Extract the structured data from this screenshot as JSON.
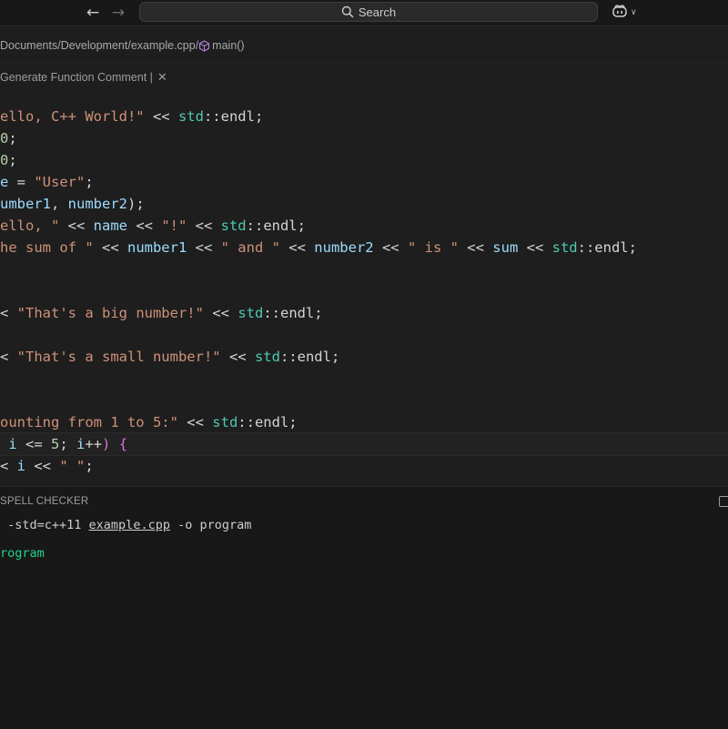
{
  "titlebar": {
    "search_label": "Search"
  },
  "breadcrumb": {
    "path": "Documents/Development/example.cpp/",
    "symbol": "main()"
  },
  "inline_hint": {
    "label": "Generate Function Comment |"
  },
  "code_lines": [
    [
      [
        "t-str",
        "ello, C++ World!\""
      ],
      [
        "t-op",
        " << "
      ],
      [
        "t-ns",
        "std"
      ],
      [
        "t-op",
        "::"
      ],
      [
        "t-plain",
        "endl;"
      ]
    ],
    [
      [
        "t-num",
        "0"
      ],
      [
        "t-plain",
        ";"
      ]
    ],
    [
      [
        "t-num",
        "0"
      ],
      [
        "t-plain",
        ";"
      ]
    ],
    [
      [
        "t-var",
        "e"
      ],
      [
        "t-op",
        " = "
      ],
      [
        "t-str",
        "\"User\""
      ],
      [
        "t-plain",
        ";"
      ]
    ],
    [
      [
        "t-var",
        "umber1"
      ],
      [
        "t-plain",
        ", "
      ],
      [
        "t-var",
        "number2"
      ],
      [
        "t-plain",
        ");"
      ]
    ],
    [
      [
        "t-str",
        "ello, \""
      ],
      [
        "t-op",
        " << "
      ],
      [
        "t-var",
        "name"
      ],
      [
        "t-op",
        " << "
      ],
      [
        "t-str",
        "\"!\""
      ],
      [
        "t-op",
        " << "
      ],
      [
        "t-ns",
        "std"
      ],
      [
        "t-op",
        "::"
      ],
      [
        "t-plain",
        "endl;"
      ]
    ],
    [
      [
        "t-str",
        "he sum of \""
      ],
      [
        "t-op",
        " << "
      ],
      [
        "t-var",
        "number1"
      ],
      [
        "t-op",
        " << "
      ],
      [
        "t-str",
        "\" and \""
      ],
      [
        "t-op",
        " << "
      ],
      [
        "t-var",
        "number2"
      ],
      [
        "t-op",
        " << "
      ],
      [
        "t-str",
        "\" is \""
      ],
      [
        "t-op",
        " << "
      ],
      [
        "t-var",
        "sum"
      ],
      [
        "t-op",
        " << "
      ],
      [
        "t-ns",
        "std"
      ],
      [
        "t-op",
        "::"
      ],
      [
        "t-plain",
        "endl;"
      ]
    ],
    [],
    [],
    [
      [
        "t-op",
        "< "
      ],
      [
        "t-str",
        "\"That's a big number!\""
      ],
      [
        "t-op",
        " << "
      ],
      [
        "t-ns",
        "std"
      ],
      [
        "t-op",
        "::"
      ],
      [
        "t-plain",
        "endl;"
      ]
    ],
    [],
    [
      [
        "t-op",
        "< "
      ],
      [
        "t-str",
        "\"That's a small number!\""
      ],
      [
        "t-op",
        " << "
      ],
      [
        "t-ns",
        "std"
      ],
      [
        "t-op",
        "::"
      ],
      [
        "t-plain",
        "endl;"
      ]
    ],
    [],
    [],
    [
      [
        "t-str",
        "ounting from 1 to 5:\""
      ],
      [
        "t-op",
        " << "
      ],
      [
        "t-ns",
        "std"
      ],
      [
        "t-op",
        "::"
      ],
      [
        "t-plain",
        "endl;"
      ]
    ],
    [
      [
        "t-var",
        " i"
      ],
      [
        "t-op",
        " <= "
      ],
      [
        "t-num",
        "5"
      ],
      [
        "t-plain",
        "; "
      ],
      [
        "t-var",
        "i"
      ],
      [
        "t-op",
        "++"
      ],
      [
        "t-brace",
        ") {"
      ]
    ],
    [
      [
        "t-op",
        "< "
      ],
      [
        "t-var",
        "i"
      ],
      [
        "t-op",
        " << "
      ],
      [
        "t-str",
        "\" \""
      ],
      [
        "t-plain",
        ";"
      ]
    ]
  ],
  "active_line_index": 15,
  "panel": {
    "tab_label": "SPELL CHECKER",
    "terminal_cmd_prefix": " -std=c++11 ",
    "terminal_cmd_file": "example.cpp",
    "terminal_cmd_suffix": " -o program",
    "terminal_output": "rogram"
  },
  "colors": {
    "editor_bg": "#1e1e1e",
    "string": "#ce9178",
    "namespace": "#4ec9b0",
    "variable": "#9cdcfe",
    "number": "#b5cea8",
    "terminal_green": "#23d18b"
  },
  "icons": [
    "arrow-left-icon",
    "arrow-right-icon",
    "search-icon",
    "copilot-icon",
    "chevron-down-icon",
    "symbol-method-icon",
    "close-icon",
    "maximize-panel-icon"
  ]
}
